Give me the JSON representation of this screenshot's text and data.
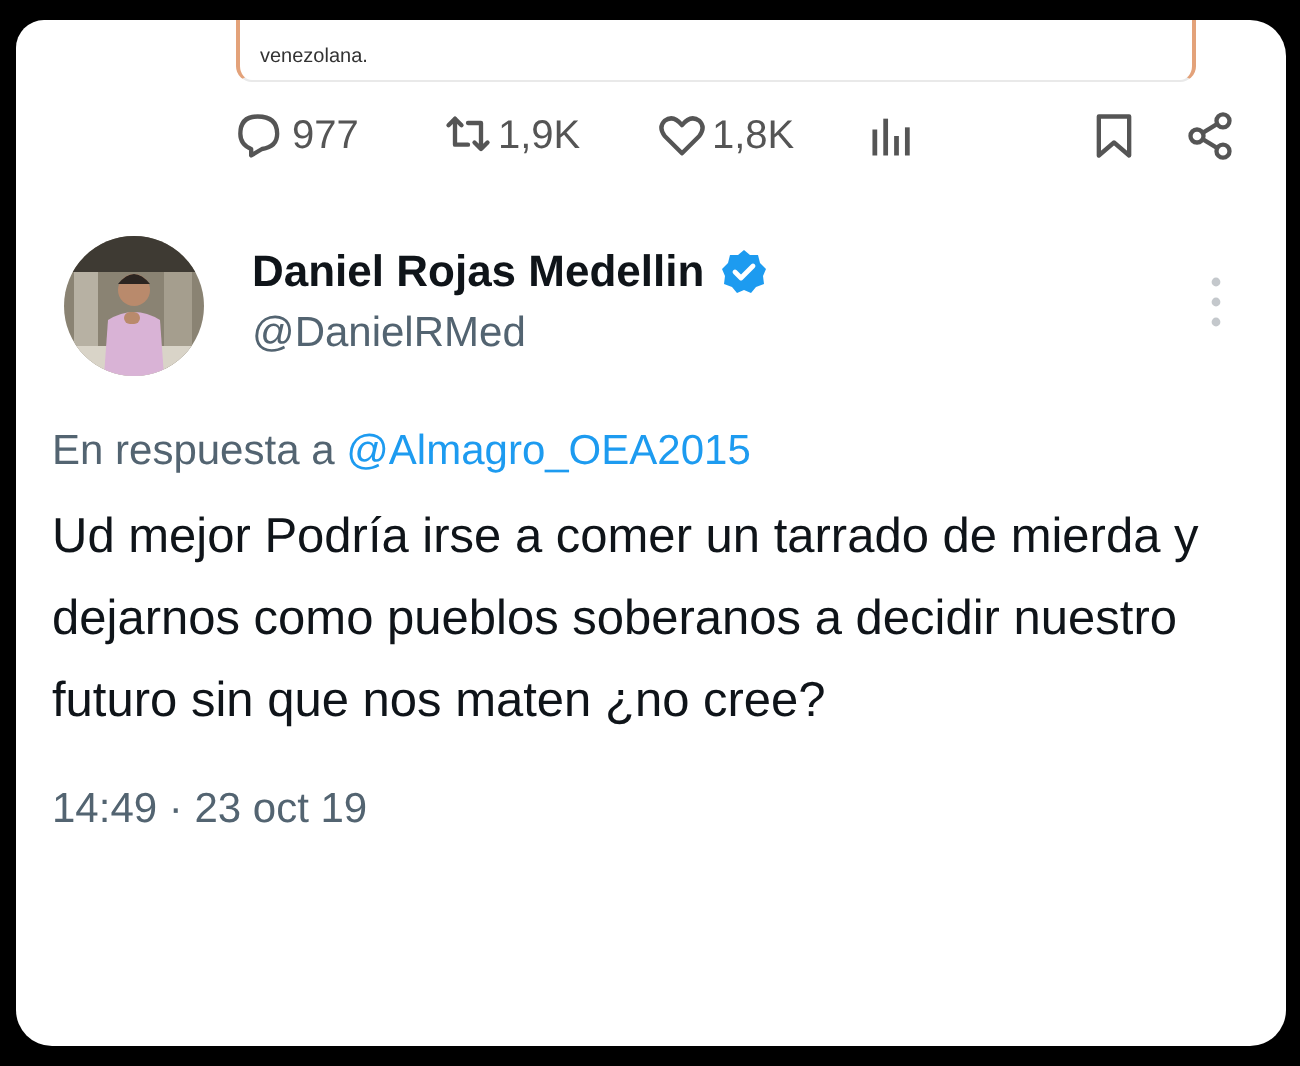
{
  "quoted_tweet": {
    "text": "venezolana."
  },
  "actions": [
    {
      "kind": "reply",
      "count": "977"
    },
    {
      "kind": "retweet",
      "count": "1,9K"
    },
    {
      "kind": "like",
      "count": "1,8K"
    },
    {
      "kind": "views"
    },
    {
      "kind": "bookmark"
    },
    {
      "kind": "share"
    }
  ],
  "author": {
    "name": "Daniel Rojas Medellin",
    "verified": true,
    "handle": "@DanielRMed"
  },
  "reply_to": {
    "prefix": "En respuesta a",
    "handle": "@Almagro_OEA2015"
  },
  "text": "Ud mejor Podría irse a comer un tarrado de mierda y dejarnos como pueblos soberanos a decidir nuestro futuro sin que nos maten ¿no cree?",
  "timestamp": "14:49 · 23 oct 19"
}
